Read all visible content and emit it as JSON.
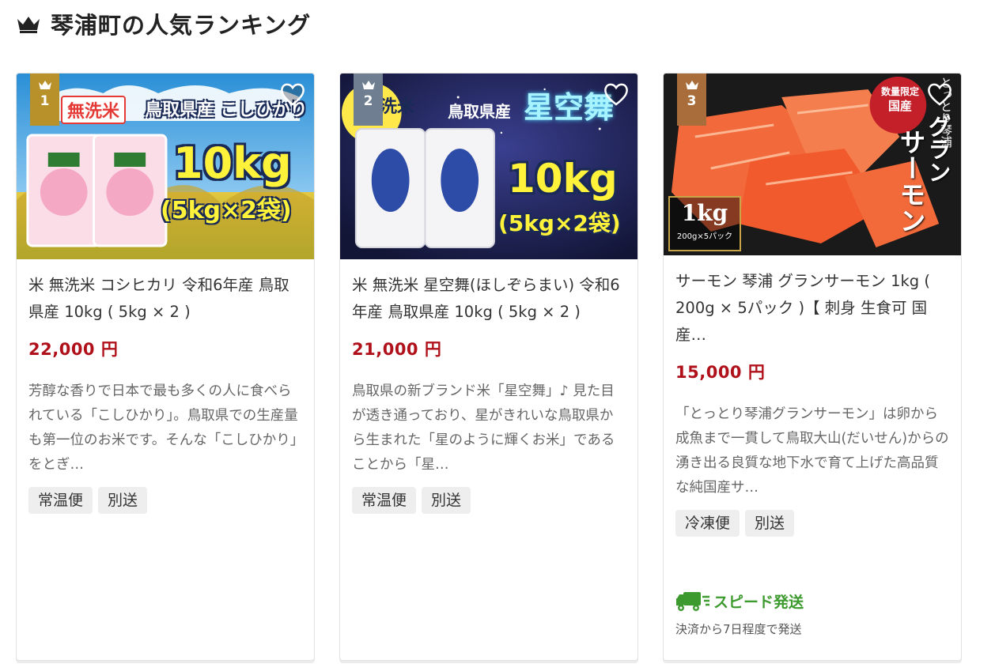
{
  "header": {
    "title": "琴浦町の人気ランキング",
    "icon": "crown-icon"
  },
  "colors": {
    "price": "#b0101a",
    "gold": "#b8912a",
    "silver": "#6f7f91",
    "bronze": "#a86d3a",
    "speed": "#3d9a2e"
  },
  "products": [
    {
      "rank": "1",
      "image_text": {
        "main_badge": "無洗米",
        "origin": "鳥取県産 こしひかり",
        "weight": "10kg",
        "pack": "(5kg×2袋)"
      },
      "title": "米 無洗米 コシヒカリ 令和6年産 鳥取県産 10kg ( 5kg × 2 )",
      "price": "22,000 円",
      "description": "芳醇な香りで日本で最も多くの人に食べられている「こしひかり」。鳥取県での生産量も第一位のお米です。そんな「こしひかり」をとぎ…",
      "tags": [
        "常温便",
        "別送"
      ]
    },
    {
      "rank": "2",
      "image_text": {
        "main_badge": "洗米",
        "origin": "鳥取県産",
        "brand": "星空舞",
        "weight": "10kg",
        "pack": "(5kg×2袋)"
      },
      "title": "米 無洗米 星空舞(ほしぞらまい) 令和6年産 鳥取県産 10kg ( 5kg × 2 )",
      "price": "21,000 円",
      "description": "鳥取県の新ブランド米「星空舞」♪ 見た目が透き通っており、星がきれいな鳥取県から生まれた「星のように輝くお米」であることから「星…",
      "tags": [
        "常温便",
        "別送"
      ]
    },
    {
      "rank": "3",
      "image_text": {
        "limited": "数量限定",
        "domestic": "国産",
        "brand_v1": "グラン",
        "brand_v2": "サーモン",
        "place": "とっとり琴浦",
        "weight": "1kg",
        "pack": "200g×5パック"
      },
      "title": "サーモン 琴浦 グランサーモン 1kg ( 200g × 5パック )【 刺身 生食可 国産…",
      "price": "15,000 円",
      "description": "「とっとり琴浦グランサーモン」は卵から成魚まで一貫して鳥取大山(だいせん)からの湧き出る良質な地下水で育て上げた高品質な純国産サ…",
      "tags": [
        "冷凍便",
        "別送"
      ],
      "shipping": {
        "label": "スピード発送",
        "note": "決済から7日程度で発送"
      }
    }
  ]
}
